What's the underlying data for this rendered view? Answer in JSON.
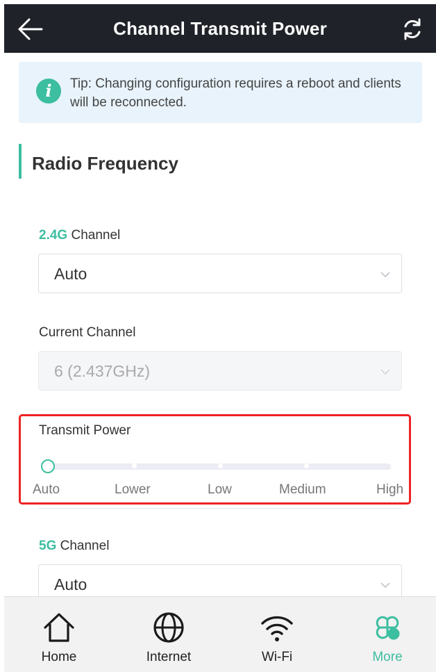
{
  "header": {
    "title": "Channel Transmit Power"
  },
  "tip": {
    "text": "Tip: Changing configuration requires a reboot and clients will be reconnected."
  },
  "section": {
    "title": "Radio Frequency"
  },
  "band_24": {
    "band": "2.4G",
    "label_suffix": " Channel",
    "value": "Auto"
  },
  "current_channel": {
    "label": "Current Channel",
    "value": "6  (2.437GHz)"
  },
  "transmit_power": {
    "label": "Transmit Power",
    "levels": [
      "Auto",
      "Lower",
      "Low",
      "Medium",
      "High"
    ],
    "selected": "Auto"
  },
  "band_5": {
    "band": "5G",
    "label_suffix": " Channel",
    "value": "Auto"
  },
  "tabs": [
    {
      "label": "Home",
      "icon": "home-icon"
    },
    {
      "label": "Internet",
      "icon": "globe-icon"
    },
    {
      "label": "Wi-Fi",
      "icon": "wifi-icon"
    },
    {
      "label": "More",
      "icon": "more-grid-icon",
      "active": true
    }
  ],
  "colors": {
    "accent": "#3cbea0",
    "header_bg": "#1f2329",
    "highlight": "#ee2222"
  }
}
